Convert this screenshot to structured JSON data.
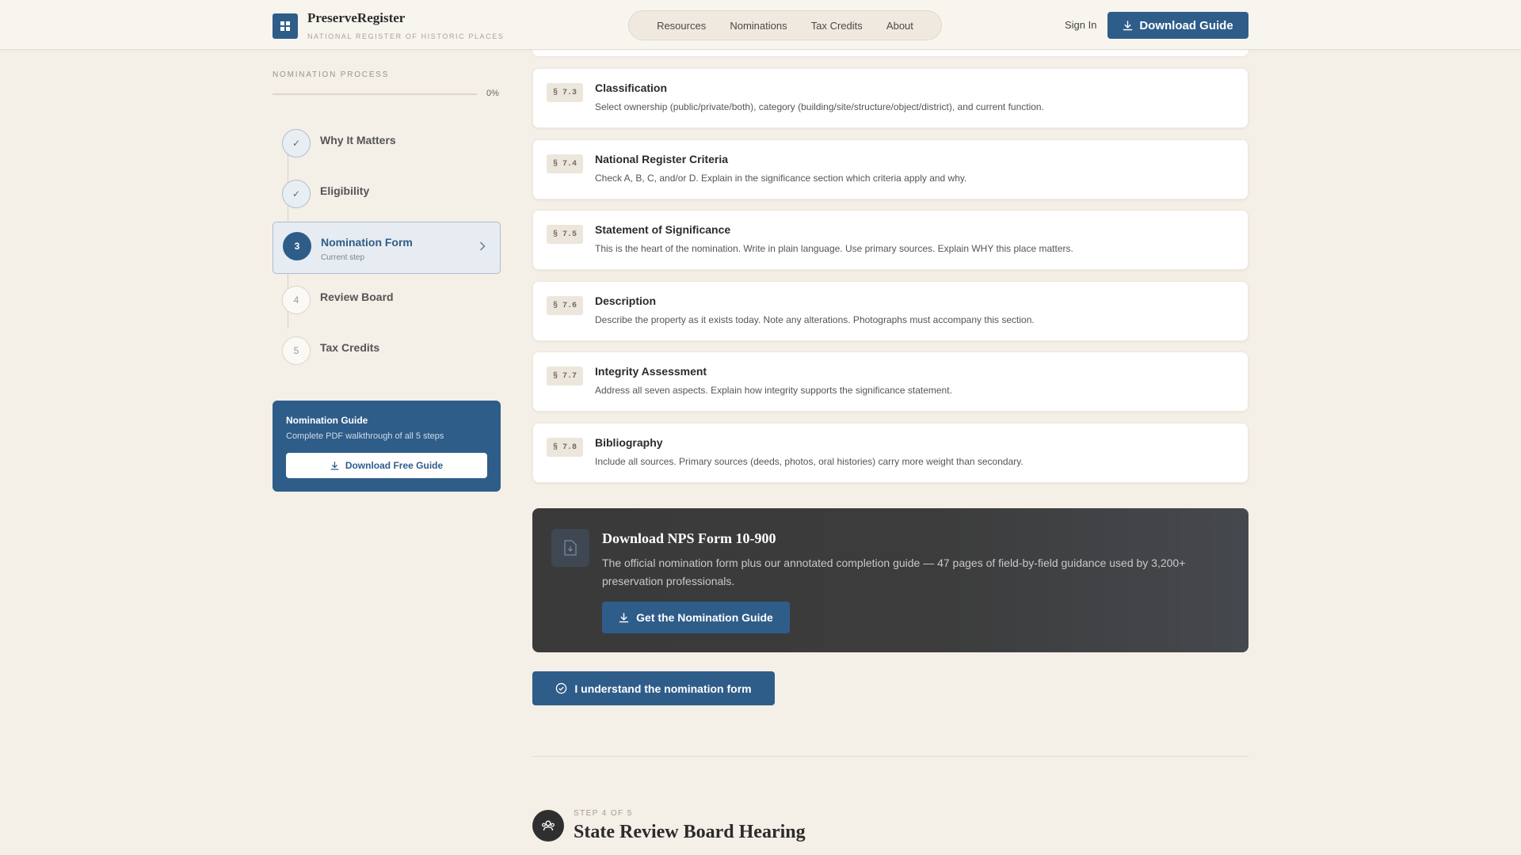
{
  "brand": {
    "name": "PreserveRegister",
    "subtitle": "NATIONAL REGISTER OF HISTORIC PLACES"
  },
  "nav": {
    "items": [
      "Resources",
      "Nominations",
      "Tax Credits",
      "About"
    ],
    "sign_in": "Sign In",
    "download_label": "Download Guide"
  },
  "sidebar": {
    "title": "NOMINATION PROCESS",
    "progress_percent": 0,
    "progress_label": "0%",
    "steps": [
      {
        "marker": "✓",
        "label": "Why It Matters",
        "state": "done"
      },
      {
        "marker": "✓",
        "label": "Eligibility",
        "state": "done"
      },
      {
        "marker": "3",
        "label": "Nomination Form",
        "state": "current",
        "sub": "Current step"
      },
      {
        "marker": "4",
        "label": "Review Board",
        "state": "upcoming"
      },
      {
        "marker": "5",
        "label": "Tax Credits",
        "state": "upcoming"
      }
    ],
    "guide": {
      "title": "Nomination Guide",
      "subtitle": "Complete PDF walkthrough of all 5 steps",
      "button": "Download Free Guide"
    }
  },
  "sections": [
    {
      "tag": "§ 7.3",
      "title": "Classification",
      "desc": "Select ownership (public/private/both), category (building/site/structure/object/district), and current function."
    },
    {
      "tag": "§ 7.4",
      "title": "National Register Criteria",
      "desc": "Check A, B, C, and/or D. Explain in the significance section which criteria apply and why."
    },
    {
      "tag": "§ 7.5",
      "title": "Statement of Significance",
      "desc": "This is the heart of the nomination. Write in plain language. Use primary sources. Explain WHY this place matters."
    },
    {
      "tag": "§ 7.6",
      "title": "Description",
      "desc": "Describe the property as it exists today. Note any alterations. Photographs must accompany this section."
    },
    {
      "tag": "§ 7.7",
      "title": "Integrity Assessment",
      "desc": "Address all seven aspects. Explain how integrity supports the significance statement."
    },
    {
      "tag": "§ 7.8",
      "title": "Bibliography",
      "desc": "Include all sources. Primary sources (deeds, photos, oral histories) carry more weight than secondary."
    }
  ],
  "download_panel": {
    "title": "Download NPS Form 10-900",
    "desc": "The official nomination form plus our annotated completion guide — 47 pages of field-by-field guidance used by 3,200+ preservation professionals.",
    "button": "Get the Nomination Guide"
  },
  "confirm_button": "I understand the nomination form",
  "next_step": {
    "kicker": "STEP 4 OF 5",
    "title": "State Review Board Hearing"
  },
  "colors": {
    "accent": "#2f5d8a",
    "background": "#f4efe7",
    "dark_panel": "#3a3a3a"
  }
}
